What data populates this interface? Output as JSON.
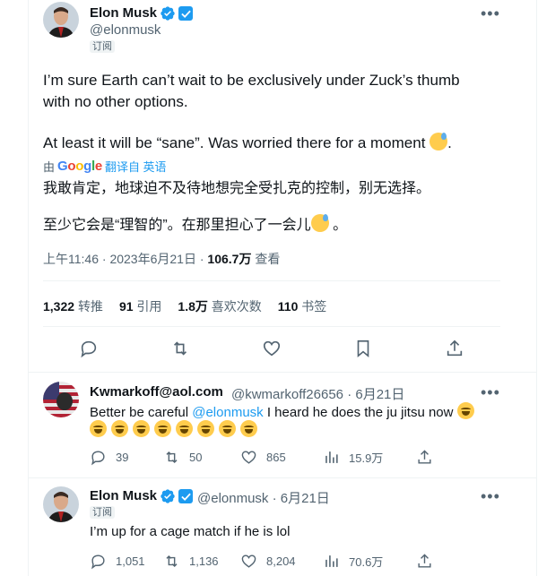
{
  "main_tweet": {
    "author_name": "Elon Musk",
    "author_handle": "@elonmusk",
    "subscribe_label": "订阅",
    "text_line1": "I’m sure Earth can’t wait to be exclusively under Zuck’s thumb",
    "text_line2": "with no other options.",
    "text_line3": "At least it will be “sane”. Was worried there for a moment",
    "text_line3_end": ".",
    "translate_prefix": "由",
    "translate_brand": "Google",
    "translate_link": "翻译自 英语",
    "cn_line1": "我敢肯定，地球迫不及待地想完全受扎克的控制，别无选择。",
    "cn_line2": "至少它会是“理智的”。在那里担心了一会儿",
    "cn_line2_end": "。",
    "time": "上午11:46",
    "date": "2023年6月21日",
    "views_count": "106.7万",
    "views_label": "查看",
    "retweets_count": "1,322",
    "retweets_label": "转推",
    "quotes_count": "91",
    "quotes_label": "引用",
    "likes_count": "1.8万",
    "likes_label": "喜欢次数",
    "bookmarks_count": "110",
    "bookmarks_label": "书签"
  },
  "reply1": {
    "author_name": "Kwmarkoff@aol.com",
    "author_handle": "@kwmarkoff26656",
    "date": "· 6月21日",
    "text_prefix": "Better be careful",
    "mention": "@elonmusk",
    "text_suffix": "I heard he does the ju jitsu now",
    "replies": "39",
    "retweets": "50",
    "likes": "865",
    "views": "15.9万"
  },
  "reply2": {
    "author_name": "Elon Musk",
    "author_handle": "@elonmusk",
    "date": "· 6月21日",
    "subscribe_label": "订阅",
    "text": "I’m up for a cage match if he is lol",
    "replies": "1,051",
    "retweets": "1,136",
    "likes": "8,204",
    "views": "70.6万"
  },
  "colors": {
    "accent": "#1d9bf0",
    "text_primary": "#0f1419",
    "text_secondary": "#536471",
    "divider": "#eff3f4"
  },
  "icons": [
    "verified-icon",
    "subscriber-badge-icon",
    "more-icon",
    "reply-icon",
    "retweet-icon",
    "like-icon",
    "bookmark-icon",
    "share-icon",
    "views-icon"
  ]
}
